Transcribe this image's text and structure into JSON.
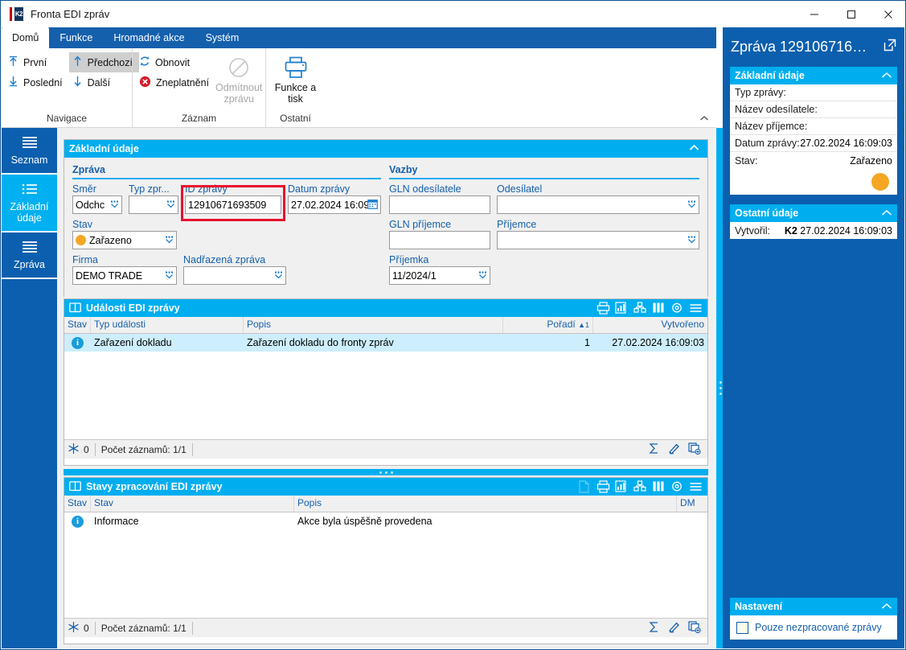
{
  "window": {
    "title": "Fronta EDI zpráv",
    "logo_text": "K2",
    "minimize": "minimize-icon",
    "maximize": "maximize-icon",
    "close": "close-icon"
  },
  "ribbon": {
    "tabs": [
      {
        "label": "Domů",
        "active": true
      },
      {
        "label": "Funkce",
        "active": false
      },
      {
        "label": "Hromadné akce",
        "active": false
      },
      {
        "label": "Systém",
        "active": false
      }
    ],
    "groups": [
      {
        "label": "Navigace",
        "items": [
          {
            "label": "První",
            "icon": "arrow-up-first-icon"
          },
          {
            "label": "Poslední",
            "icon": "arrow-down-last-icon"
          },
          {
            "label": "Předchozí",
            "icon": "arrow-up-icon",
            "selected": true
          },
          {
            "label": "Další",
            "icon": "arrow-down-icon"
          }
        ]
      },
      {
        "label": "Záznam",
        "items": [
          {
            "label": "Obnovit",
            "icon": "refresh-icon"
          },
          {
            "label": "Zneplatnění",
            "icon": "cancel-red-icon"
          },
          {
            "label": "Odmítnout zprávu",
            "icon": "forbidden-icon",
            "disabled": true
          }
        ]
      },
      {
        "label": "Ostatní",
        "items": [
          {
            "label": "Funkce a tisk",
            "icon": "printer-icon"
          }
        ]
      }
    ],
    "collapse": "chevron-up-icon"
  },
  "left_tabs": [
    {
      "label": "Seznam",
      "icon": "list-lines-icon",
      "active": false
    },
    {
      "label": "Základní údaje",
      "icon": "list-bullets-icon",
      "active": true
    },
    {
      "label": "Zpráva",
      "icon": "list-lines-icon",
      "active": false
    }
  ],
  "basic_panel": {
    "header": "Základní údaje",
    "collapse_icon": "chevron-up-icon",
    "message_section": {
      "title": "Zpráva",
      "fields": {
        "smer": {
          "label": "Směr",
          "value": "Odchc"
        },
        "typ_zpr": {
          "label": "Typ zpr...",
          "value": ""
        },
        "id_zpravy": {
          "label": "ID zprávy",
          "value": "12910671693509"
        },
        "datum_zpravy": {
          "label": "Datum zprávy",
          "value": "27.02.2024 16:09:"
        },
        "stav": {
          "label": "Stav",
          "value": "Zařazeno"
        },
        "firma": {
          "label": "Firma",
          "value": "DEMO TRADE"
        },
        "nadrazena": {
          "label": "Nadřazená zpráva",
          "value": ""
        }
      }
    },
    "relations_section": {
      "title": "Vazby",
      "fields": {
        "gln_odesilatele": {
          "label": "GLN odesílatele",
          "value": ""
        },
        "odesilatel": {
          "label": "Odesílatel",
          "value": ""
        },
        "gln_prijemce": {
          "label": "GLN příjemce",
          "value": ""
        },
        "prijemce": {
          "label": "Příjemce",
          "value": ""
        },
        "prijemka": {
          "label": "Příjemka",
          "value": "11/2024/1"
        }
      }
    }
  },
  "events_grid": {
    "header": "Události EDI zprávy",
    "header_icon": "book-icon",
    "toolbar": [
      "print-icon",
      "chart-icon",
      "pivot-icon",
      "columns-icon",
      "settings-icon",
      "menu-icon"
    ],
    "columns": [
      "Stav",
      "Typ události",
      "Popis",
      "Pořadí",
      "Vytvořeno"
    ],
    "sort_column": "Pořadí",
    "sort_indicator": "▲",
    "sort_order": "1",
    "rows": [
      {
        "state_icon": "info-icon",
        "typ_udalosti": "Zařazení dokladu",
        "popis": "Zařazení dokladu do fronty zpráv",
        "poradi": "1",
        "vytvoreno": "27.02.2024 16:09:03"
      }
    ],
    "status": {
      "filter_icon": "snowflake-icon",
      "filter_count": "0",
      "record_count": "Počet záznamů: 1/1",
      "right_icons": [
        "sum-icon",
        "edit-icon",
        "new-record-icon"
      ]
    }
  },
  "states_grid": {
    "header": "Stavy zpracování EDI zprávy",
    "header_icon": "book-icon",
    "toolbar": [
      "page-icon",
      "print-icon",
      "chart-icon",
      "pivot-icon",
      "columns-icon",
      "settings-icon",
      "menu-icon"
    ],
    "columns": [
      "Stav",
      "Stav",
      "Popis",
      "DM"
    ],
    "rows": [
      {
        "state_icon": "info-icon",
        "stav": "Informace",
        "popis": "Akce byla úspěšně provedena",
        "dm": ""
      }
    ],
    "status": {
      "filter_icon": "snowflake-icon",
      "filter_count": "0",
      "record_count": "Počet záznamů: 1/1",
      "right_icons": [
        "sum-icon",
        "edit-icon",
        "new-record-icon"
      ]
    }
  },
  "sidebar": {
    "title": "Zpráva 129106716…",
    "popout_icon": "popout-icon",
    "cards": [
      {
        "header": "Základní údaje",
        "collapse_icon": "chevron-up-icon",
        "rows": [
          {
            "label": "Typ zprávy:",
            "value": ""
          },
          {
            "label": "Název odesílatele:",
            "value": ""
          },
          {
            "label": "Název příjemce:",
            "value": ""
          },
          {
            "label": "Datum zprávy:",
            "value": "27.02.2024 16:09:03"
          },
          {
            "label": "Stav:",
            "value": "Zařazeno"
          }
        ],
        "status_dot_color": "#f5a623"
      },
      {
        "header": "Ostatní údaje",
        "collapse_icon": "chevron-up-icon",
        "rows": [
          {
            "label": "Vytvořil:",
            "value_bold": "K2",
            "value": "27.02.2024 16:09:03"
          }
        ]
      }
    ],
    "settings_card": {
      "header": "Nastavení",
      "collapse_icon": "chevron-up-icon",
      "checkbox": {
        "label": "Pouze nezpracované zprávy",
        "checked": false
      }
    }
  },
  "colors": {
    "accent_cyan": "#00aeef",
    "ribbon_blue": "#1560ad",
    "sidebar_blue": "#0b5fae",
    "status_orange": "#f5a623",
    "highlight_red": "#e8112d",
    "row_selected": "#cdeefc"
  }
}
